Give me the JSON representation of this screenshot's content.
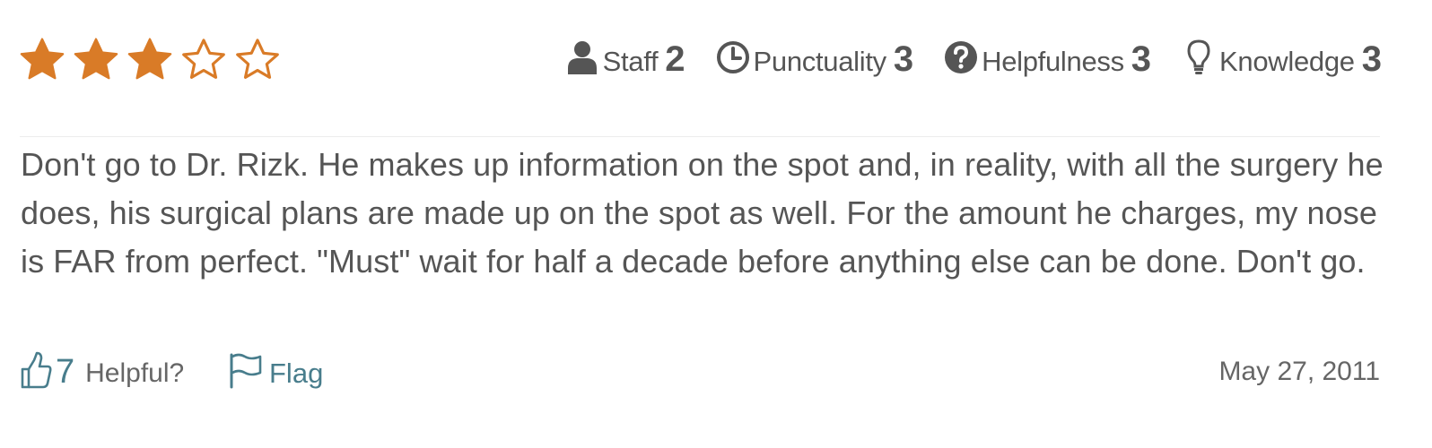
{
  "review": {
    "stars": {
      "rating": 3,
      "max": 5,
      "color": "#d97b27"
    },
    "ratings": [
      {
        "label": "Staff",
        "score": "2",
        "icon": "user-icon"
      },
      {
        "label": "Punctuality",
        "score": "3",
        "icon": "clock-icon"
      },
      {
        "label": "Helpfulness",
        "score": "3",
        "icon": "question-circle-icon"
      },
      {
        "label": "Knowledge",
        "score": "3",
        "icon": "lightbulb-icon"
      }
    ],
    "text": "Don't go to Dr. Rizk. He makes up information on the spot and, in reality, with all the surgery he does, his surgical plans are made up on the spot as well. For the amount he charges, my nose is FAR from perfect. \"Must\" wait for half a decade before anything else can be done. Don't go.",
    "footer": {
      "helpful_count": "7",
      "helpful_label": "Helpful?",
      "flag_label": "Flag",
      "date": "May 27, 2011"
    },
    "colors": {
      "accent": "#487d8c",
      "text": "#555555",
      "star": "#d97b27"
    }
  }
}
